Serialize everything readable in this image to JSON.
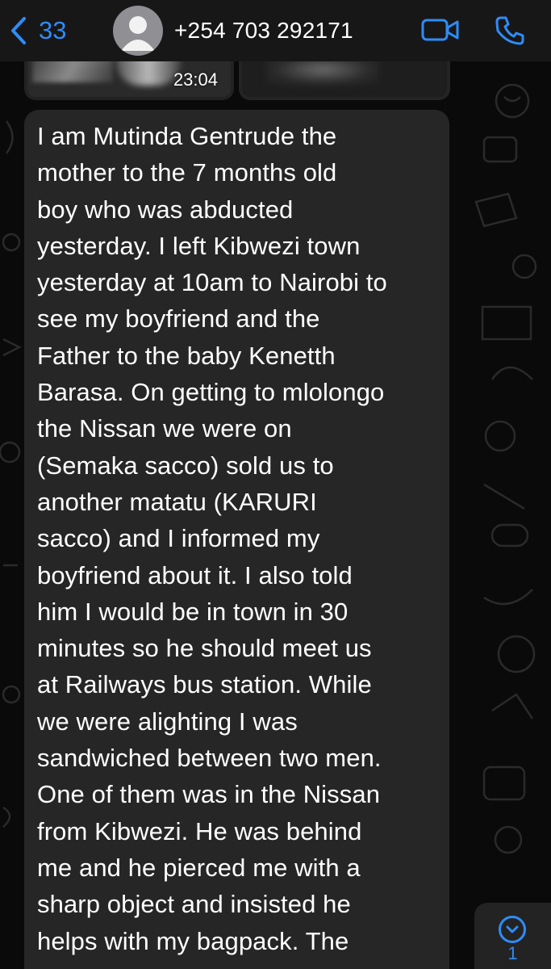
{
  "header": {
    "back_count": "33",
    "contact_name": "+254 703 292171",
    "icons": {
      "back": "chevron-left-icon",
      "avatar": "person-avatar-icon",
      "video": "video-camera-icon",
      "call": "phone-icon"
    },
    "accent_color": "#2f8cf7"
  },
  "previous_message": {
    "time": "23:04"
  },
  "message": {
    "text": "I am Mutinda Gentrude the\nmother to the 7 months old\nboy who was abducted\nyesterday. I left  Kibwezi town\nyesterday at 10am to Nairobi to\nsee my boyfriend and the\nFather to the baby Kenetth\nBarasa. On getting to mlolongo\nthe Nissan we were on\n(Semaka sacco) sold us to\nanother matatu (KARURI\nsacco) and I informed my\nboyfriend about it. I also told\nhim I would be in town in 30\nminutes so he should meet us\nat Railways bus station. While\nwe were alighting I was\nsandwiched between two men.\nOne of them was in the Nissan\nfrom Kibwezi. He was behind\nme and he pierced me with a\nsharp object and insisted he\nhelps with my bagpack. The",
    "bubble_color": "#262626"
  },
  "scroll_button": {
    "unread_count": "1",
    "icon": "chevron-down-icon"
  }
}
